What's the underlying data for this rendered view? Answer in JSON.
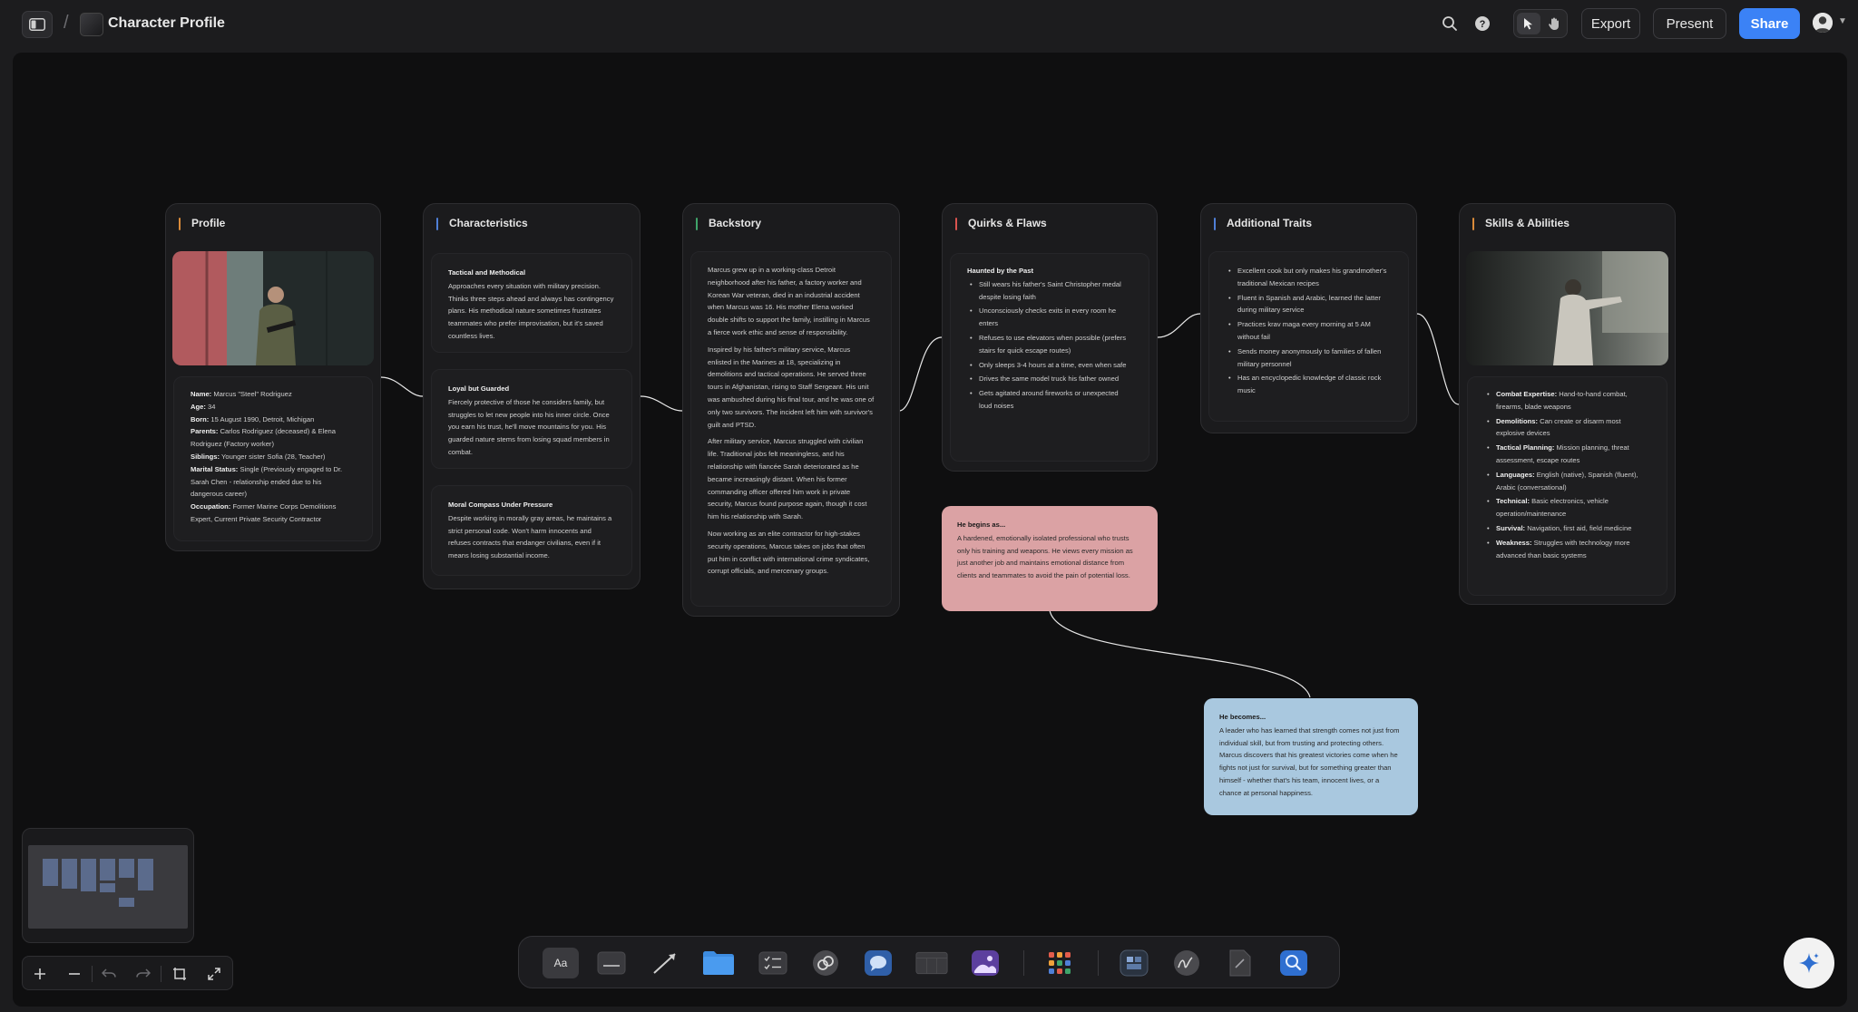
{
  "header": {
    "title": "Character Profile",
    "breadcrumb_sep": "/",
    "export_label": "Export",
    "present_label": "Present",
    "share_label": "Share",
    "accent_color": "#3b82f6"
  },
  "cards": {
    "profile": {
      "title": "Profile",
      "accent": "#d98b3a",
      "fields": [
        {
          "label": "Name:",
          "value": "Marcus \"Steel\" Rodriguez"
        },
        {
          "label": "Age:",
          "value": "34"
        },
        {
          "label": "Born:",
          "value": "15 August 1990, Detroit, Michigan"
        },
        {
          "label": "Parents:",
          "value": "Carlos Rodriguez (deceased) & Elena Rodriguez (Factory worker)"
        },
        {
          "label": "Siblings:",
          "value": "Younger sister Sofia (28, Teacher)"
        },
        {
          "label": "Marital Status:",
          "value": "Single (Previously engaged to Dr. Sarah Chen - relationship ended due to his dangerous career)"
        },
        {
          "label": "Occupation:",
          "value": "Former Marine Corps Demolitions Expert, Current Private Security Contractor"
        }
      ]
    },
    "characteristics": {
      "title": "Characteristics",
      "accent": "#4f7fd6",
      "blocks": [
        {
          "heading": "Tactical and Methodical",
          "text": "Approaches every situation with military precision. Thinks three steps ahead and always has contingency plans. His methodical nature sometimes frustrates teammates who prefer improvisation, but it's saved countless lives."
        },
        {
          "heading": "Loyal but Guarded",
          "text": "Fiercely protective of those he considers family, but struggles to let new people into his inner circle. Once you earn his trust, he'll move mountains for you. His guarded nature stems from losing squad members in combat."
        },
        {
          "heading": "Moral Compass Under Pressure",
          "text": "Despite working in morally gray areas, he maintains a strict personal code. Won't harm innocents and refuses contracts that endanger civilians, even if it means losing substantial income."
        }
      ]
    },
    "backstory": {
      "title": "Backstory",
      "accent": "#3fa46a",
      "paragraphs": [
        "Marcus grew up in a working-class Detroit neighborhood after his father, a factory worker and Korean War veteran, died in an industrial accident when Marcus was 16. His mother Elena worked double shifts to support the family, instilling in Marcus a fierce work ethic and sense of responsibility.",
        "Inspired by his father's military service, Marcus enlisted in the Marines at 18, specializing in demolitions and tactical operations. He served three tours in Afghanistan, rising to Staff Sergeant. His unit was ambushed during his final tour, and he was one of only two survivors. The incident left him with survivor's guilt and PTSD.",
        "After military service, Marcus struggled with civilian life. Traditional jobs felt meaningless, and his relationship with fiancée Sarah deteriorated as he became increasingly distant. When his former commanding officer offered him work in private security, Marcus found purpose again, though it cost him his relationship with Sarah.",
        "Now working as an elite contractor for high-stakes security operations, Marcus takes on jobs that often put him in conflict with international crime syndicates, corrupt officials, and mercenary groups."
      ]
    },
    "quirks": {
      "title": "Quirks & Flaws",
      "accent": "#d9534f",
      "heading": "Haunted by the Past",
      "items": [
        "Still wears his father's Saint Christopher medal despite losing faith",
        "Unconsciously checks exits in every room he enters",
        "Refuses to use elevators when possible (prefers stairs for quick escape routes)",
        "Only sleeps 3-4 hours at a time, even when safe",
        "Drives the same model truck his father owned",
        "Gets agitated around fireworks or unexpected loud noises"
      ]
    },
    "additional": {
      "title": "Additional Traits",
      "accent": "#4f7fd6",
      "items": [
        "Excellent cook but only makes his grandmother's traditional Mexican recipes",
        "Fluent in Spanish and Arabic, learned the latter during military service",
        "Practices krav maga every morning at 5 AM without fail",
        "Sends money anonymously to families of fallen military personnel",
        "Has an encyclopedic knowledge of classic rock music"
      ]
    },
    "skills": {
      "title": "Skills & Abilities",
      "accent": "#d98b3a",
      "items": [
        {
          "label": "Combat Expertise:",
          "value": "Hand-to-hand combat, firearms, blade weapons"
        },
        {
          "label": "Demolitions:",
          "value": "Can create or disarm most explosive devices"
        },
        {
          "label": "Tactical Planning:",
          "value": "Mission planning, threat assessment, escape routes"
        },
        {
          "label": "Languages:",
          "value": "English (native), Spanish (fluent), Arabic (conversational)"
        },
        {
          "label": "Technical:",
          "value": "Basic electronics, vehicle operation/maintenance"
        },
        {
          "label": "Survival:",
          "value": "Navigation, first aid, field medicine"
        },
        {
          "label": "Weakness:",
          "value": "Struggles with technology more advanced than basic systems"
        }
      ]
    }
  },
  "notes": {
    "begins": {
      "heading": "He begins as...",
      "text": "A hardened, emotionally isolated professional who trusts only his training and weapons. He views every mission as just another job and maintains emotional distance from clients and teammates to avoid the pain of potential loss.",
      "color": "#dba2a4"
    },
    "becomes": {
      "heading": "He becomes...",
      "text": "A leader who has learned that strength comes not just from individual skill, but from trusting and protecting others. Marcus discovers that his greatest victories come when he fights not just for survival, but for something greater than himself - whether that's his team, innocent lives, or a chance at personal happiness.",
      "color": "#a9c8df"
    }
  },
  "toolbar": {
    "text_tool_label": "Aa",
    "tools": [
      "text-tool",
      "sticky-note-tool",
      "connector-tool",
      "folder-tool",
      "checklist-tool",
      "link-tool",
      "comment-tool",
      "table-tool",
      "image-tool",
      "apps-tool",
      "template-tool",
      "draw-tool",
      "document-tool",
      "search-tool"
    ]
  }
}
